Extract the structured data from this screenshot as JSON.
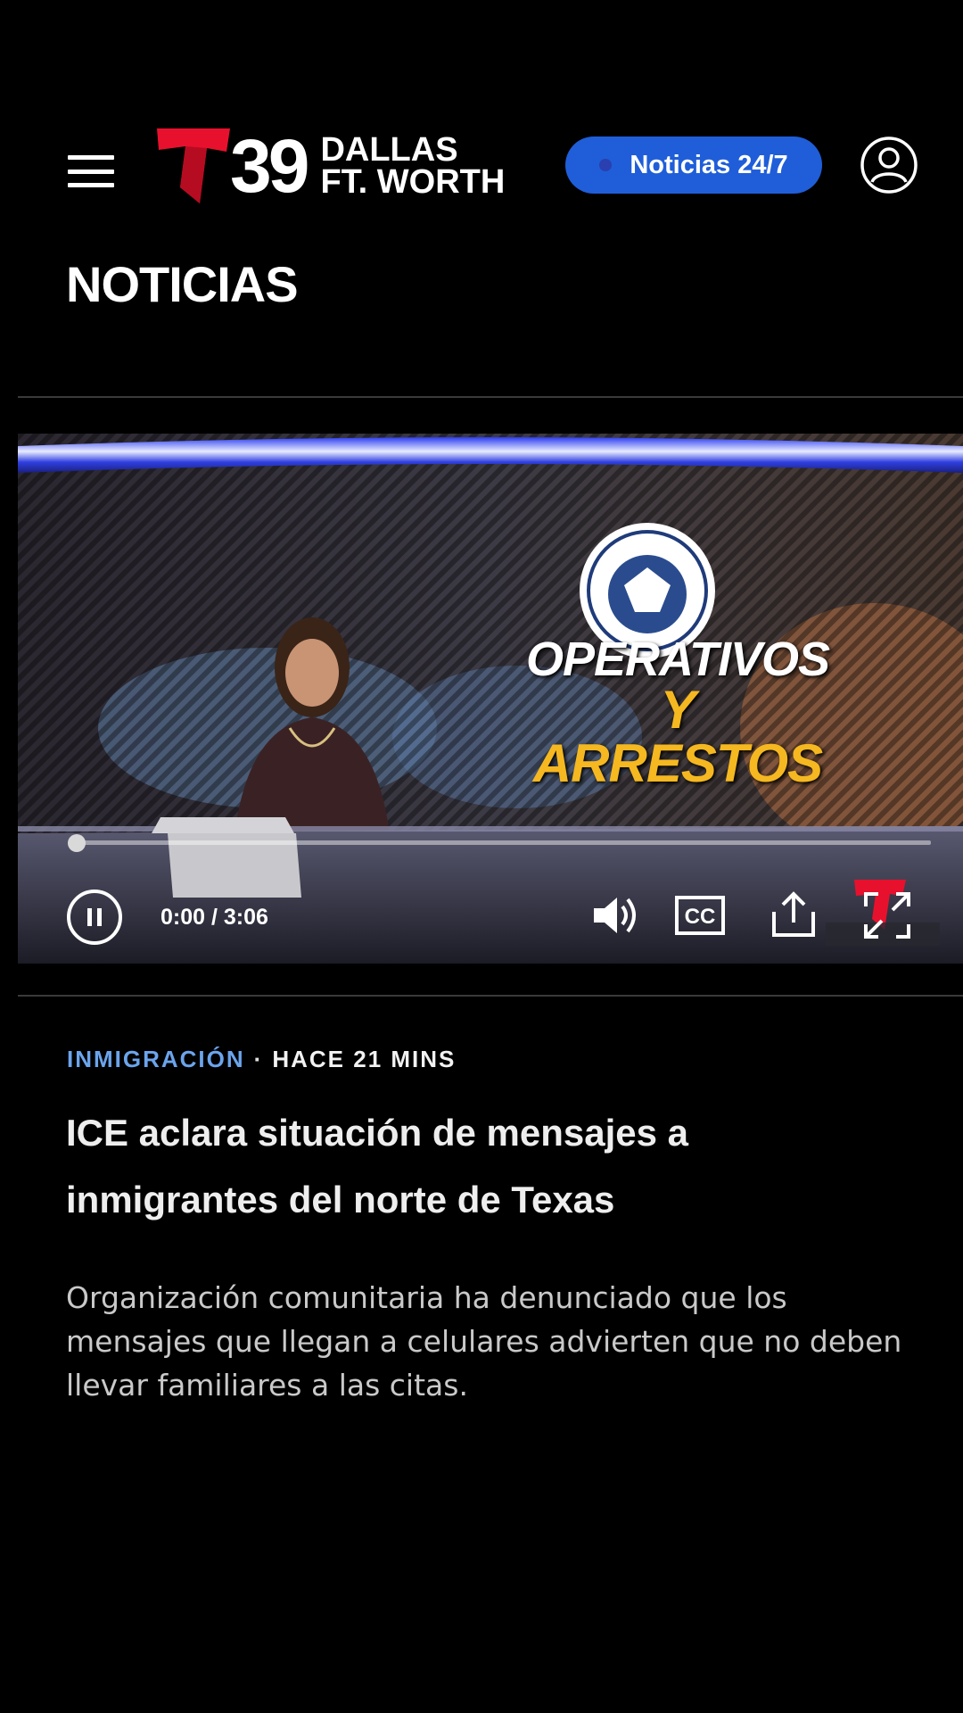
{
  "header": {
    "logo": {
      "number": "39",
      "city_line1": "DALLAS",
      "city_line2": "FT. WORTH",
      "brand_color": "#e8112d"
    },
    "live_button_label": "Noticias 24/7",
    "live_button_color": "#1f5ed8"
  },
  "section_title": "NOTICIAS",
  "video": {
    "overlay_line1": "OPERATIVOS",
    "overlay_line2": "Y ARRESTOS",
    "time_display": "0:00 / 3:06",
    "progress_fraction": 0.0,
    "controls": [
      "pause-icon",
      "volume-icon",
      "closed-captions-icon",
      "share-icon",
      "fullscreen-icon"
    ]
  },
  "article": {
    "category": "INMIGRACIÓN",
    "separator": "·",
    "time_ago": "HACE 21 MINS",
    "category_color": "#6ba4ec",
    "headline": "ICE aclara situación de mensajes a inmigrantes del norte de Texas",
    "summary": "Organización comunitaria ha denunciado que los mensajes que llegan a celulares advierten que no deben llevar familiares a las citas."
  }
}
